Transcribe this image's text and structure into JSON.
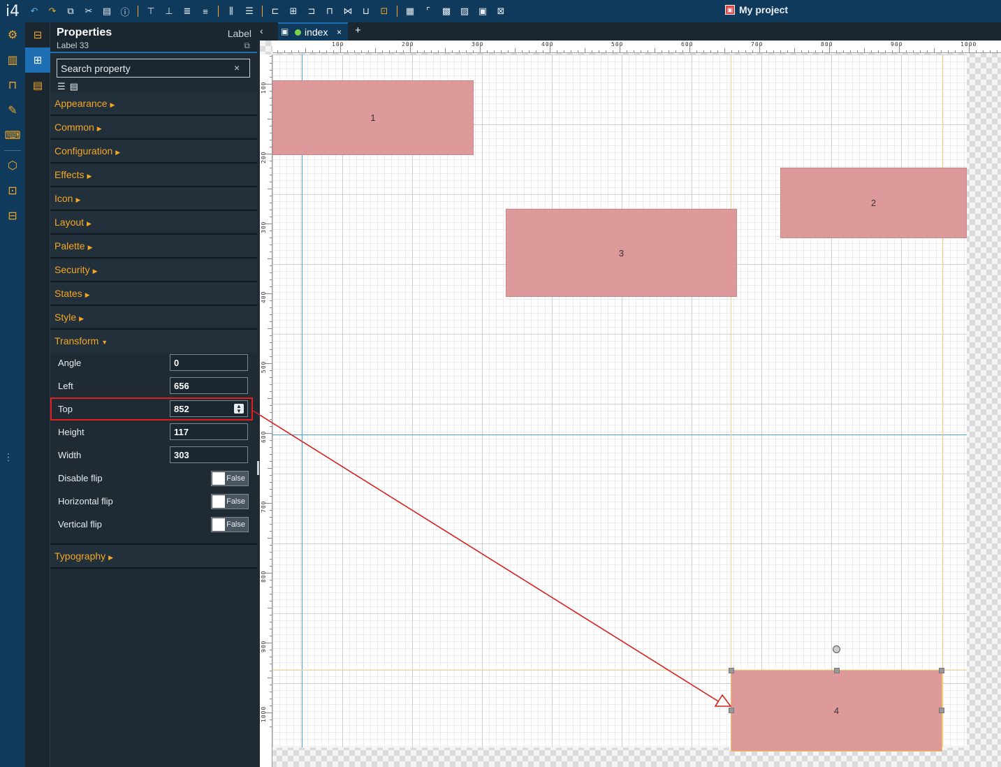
{
  "app": {
    "logo": "i4",
    "project_title": "My project",
    "project_icon": "project-icon"
  },
  "toolbar": {
    "buttons": [
      {
        "name": "undo",
        "glyph": "↶"
      },
      {
        "name": "redo",
        "glyph": "↷"
      },
      {
        "name": "duplicate",
        "glyph": "⧉"
      },
      {
        "name": "cut",
        "glyph": "✂"
      },
      {
        "name": "paste",
        "glyph": "📋"
      },
      {
        "name": "info",
        "glyph": "ⓘ"
      }
    ]
  },
  "rail": [
    "settings-gear-icon",
    "chart-icon",
    "lock-icon",
    "edit-screen-icon",
    "keyboard-icon",
    "cube-icon",
    "image-settings-icon",
    "archive-icon"
  ],
  "rail2": [
    "toolbox-icon",
    "properties-icon",
    "script-icon"
  ],
  "properties": {
    "title": "Properties",
    "subtitle": "Label 33",
    "type": "Label",
    "search_placeholder": "Search property",
    "search_clear": "×",
    "sections": [
      {
        "label": "Appearance"
      },
      {
        "label": "Common"
      },
      {
        "label": "Configuration"
      },
      {
        "label": "Effects"
      },
      {
        "label": "Icon"
      },
      {
        "label": "Layout"
      },
      {
        "label": "Palette"
      },
      {
        "label": "Security"
      },
      {
        "label": "States"
      },
      {
        "label": "Style"
      }
    ],
    "transform": {
      "label": "Transform",
      "rows": [
        {
          "label": "Angle",
          "value": "0"
        },
        {
          "label": "Left",
          "value": "656"
        },
        {
          "label": "Top",
          "value": "852"
        },
        {
          "label": "Height",
          "value": "117"
        },
        {
          "label": "Width",
          "value": "303"
        }
      ],
      "toggles": [
        {
          "label": "Disable flip",
          "value": "False"
        },
        {
          "label": "Horizontal flip",
          "value": "False"
        },
        {
          "label": "Vertical flip",
          "value": "False"
        }
      ]
    },
    "typography": {
      "label": "Typography"
    }
  },
  "tabs": {
    "back": "‹",
    "active": "index",
    "close": "×",
    "add": "+"
  },
  "canvas": {
    "ruler_top": [
      "100",
      "200",
      "300",
      "400",
      "500",
      "600",
      "700",
      "800",
      "900",
      "1000"
    ],
    "ruler_left": [
      "100",
      "200",
      "300",
      "400",
      "500",
      "600",
      "700",
      "800",
      "900",
      "1000"
    ],
    "labels": [
      {
        "text": "1"
      },
      {
        "text": "2"
      },
      {
        "text": "3"
      },
      {
        "text": "4"
      }
    ]
  },
  "colors": {
    "accent": "#f5a623",
    "brand": "#0f3a5c",
    "label_fill": "#de9a9a",
    "highlight": "#e02020"
  }
}
